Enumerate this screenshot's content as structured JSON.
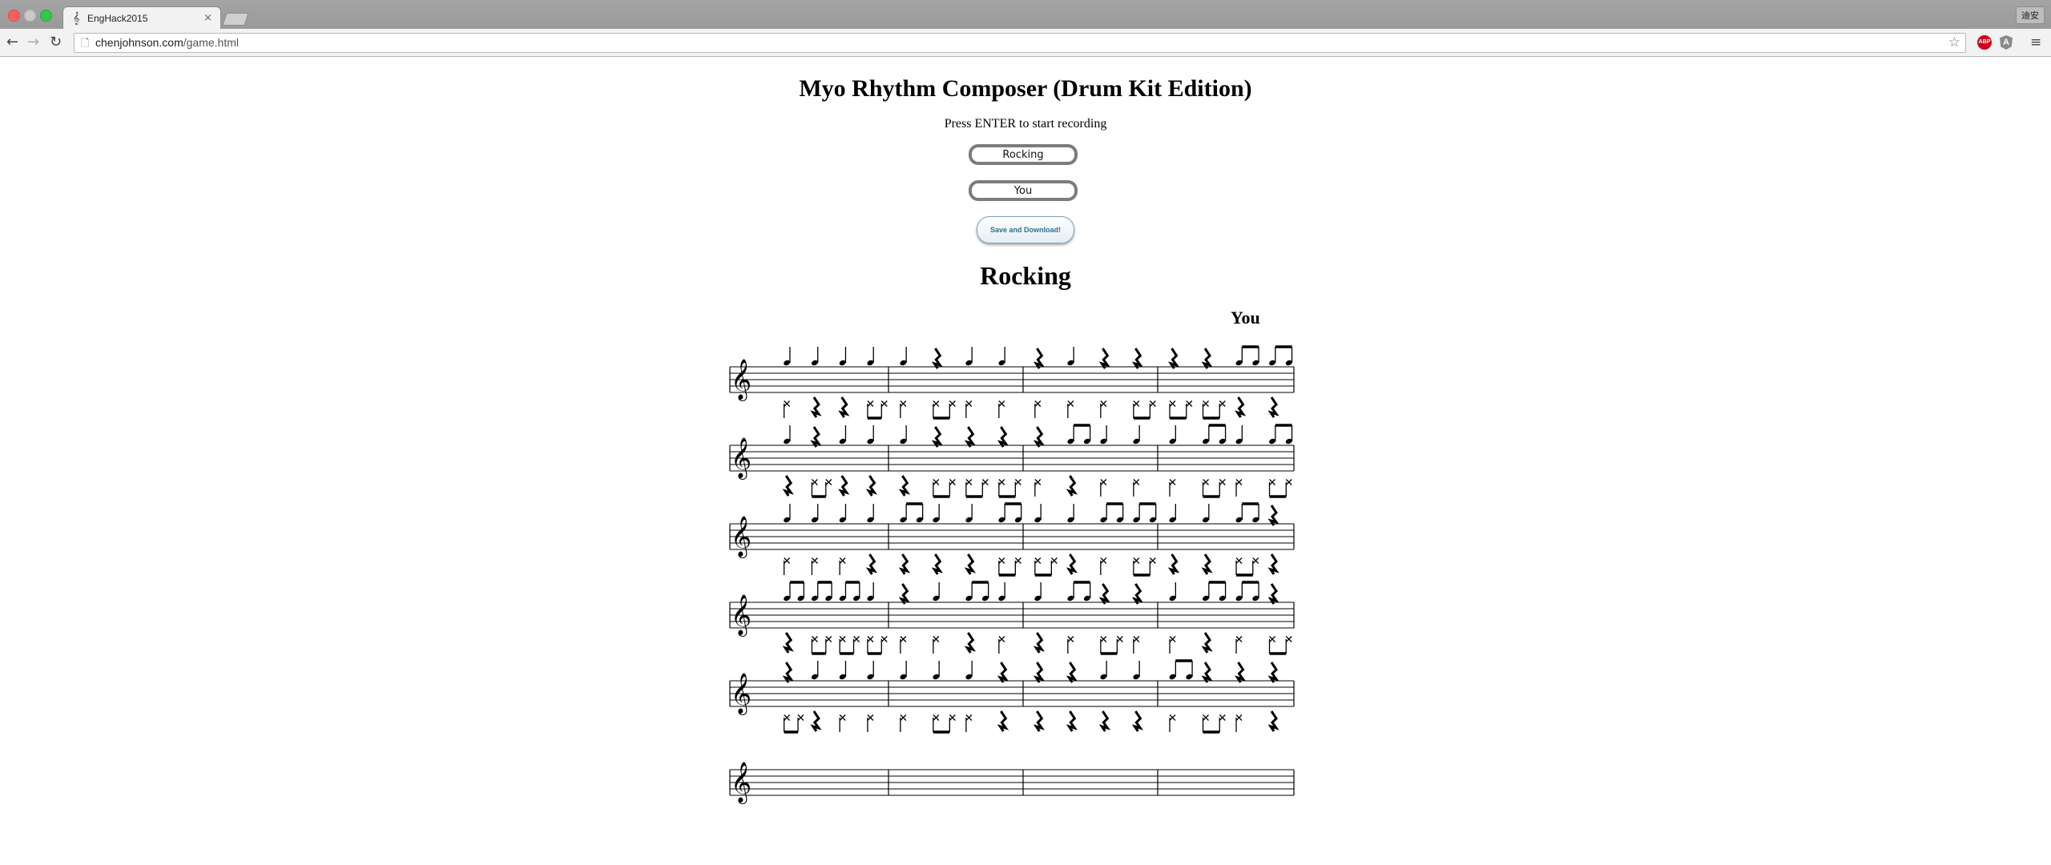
{
  "browser": {
    "tab_title": "EngHack2015",
    "tab_icon": "music-note-icon",
    "tab_close": "×",
    "url_host": "chenjohnson.com",
    "url_path": "/game.html",
    "profile_label": "迪安",
    "extension_abp": "ABP"
  },
  "page": {
    "title": "Myo Rhythm Composer (Drum Kit Edition)",
    "instruction": "Press ENTER to start recording",
    "song_title_input": "Rocking",
    "author_input": "You",
    "save_button": "Save and Download!",
    "song_title": "Rocking",
    "song_author": "You"
  },
  "score": {
    "clef": "treble",
    "systems": [
      {
        "measures": 4,
        "filled": true
      },
      {
        "measures": 4,
        "filled": true
      },
      {
        "measures": 4,
        "filled": true
      },
      {
        "measures": 4,
        "filled": true
      },
      {
        "measures": 4,
        "filled": true
      },
      {
        "measures": 4,
        "filled": false
      }
    ],
    "upper_voice": [
      [
        "q",
        "q",
        "q",
        "q",
        "q",
        "r",
        "q",
        "q",
        "r",
        "q",
        "r",
        "r",
        "r",
        "r",
        "e2",
        "e2"
      ],
      [
        "q",
        "r",
        "q",
        "q",
        "q",
        "r",
        "r",
        "r",
        "r",
        "e2",
        "q",
        "q",
        "q",
        "e2",
        "q",
        "e2"
      ],
      [
        "q",
        "q",
        "q",
        "q",
        "e2",
        "q",
        "q",
        "e2",
        "q",
        "q",
        "e2",
        "e2",
        "q",
        "q",
        "e2",
        "r"
      ],
      [
        "e2",
        "e2",
        "e2",
        "q",
        "r",
        "q",
        "e2",
        "q",
        "q",
        "e2",
        "r",
        "r",
        "q",
        "e2",
        "e2",
        "r"
      ],
      [
        "r",
        "q",
        "q",
        "q",
        "q",
        "q",
        "q",
        "r",
        "r",
        "r",
        "q",
        "q",
        "e2",
        "r",
        "r",
        "r"
      ]
    ],
    "lower_voice": [
      [
        "x",
        "r",
        "r",
        "b",
        "x",
        "b",
        "x",
        "x",
        "x",
        "x",
        "x",
        "b",
        "b",
        "b",
        "r",
        "r"
      ],
      [
        "r",
        "b",
        "r",
        "r",
        "r",
        "b",
        "b",
        "b",
        "x",
        "r",
        "x",
        "x",
        "x",
        "b",
        "x",
        "b"
      ],
      [
        "x",
        "x",
        "x",
        "r",
        "r",
        "r",
        "r",
        "b",
        "b",
        "r",
        "x",
        "b",
        "r",
        "r",
        "b",
        "r"
      ],
      [
        "r",
        "b",
        "b",
        "b",
        "x",
        "x",
        "r",
        "x",
        "r",
        "x",
        "b",
        "x",
        "x",
        "r",
        "x",
        "b"
      ],
      [
        "b",
        "r",
        "x",
        "x",
        "x",
        "b",
        "x",
        "r",
        "r",
        "r",
        "r",
        "r",
        "x",
        "b",
        "x",
        "r"
      ]
    ]
  }
}
